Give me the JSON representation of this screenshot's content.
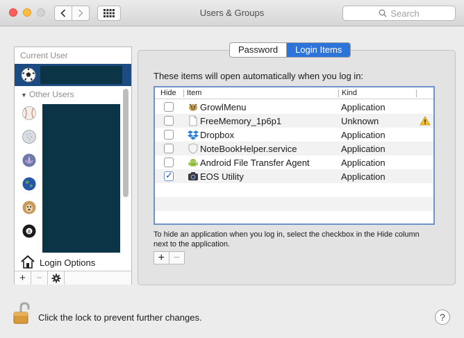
{
  "window": {
    "title": "Users & Groups",
    "search_placeholder": "Search"
  },
  "sidebar": {
    "current_user_label": "Current User",
    "other_users_label": "Other Users",
    "login_options_label": "Login Options",
    "footer": {
      "add": "+",
      "remove": "−"
    }
  },
  "tabs": [
    {
      "label": "Password",
      "active": false
    },
    {
      "label": "Login Items",
      "active": true
    }
  ],
  "login_items": {
    "intro": "These items will open automatically when you log in:",
    "columns": {
      "hide": "Hide",
      "item": "Item",
      "kind": "Kind"
    },
    "rows": [
      {
        "name": "GrowlMenu",
        "kind": "Application",
        "hidden": false,
        "icon": "growl-icon",
        "warning": false
      },
      {
        "name": "FreeMemory_1p6p1",
        "kind": "Unknown",
        "hidden": false,
        "icon": "document-icon",
        "warning": true
      },
      {
        "name": "Dropbox",
        "kind": "Application",
        "hidden": false,
        "icon": "dropbox-icon",
        "warning": false
      },
      {
        "name": "NoteBookHelper.service",
        "kind": "Application",
        "hidden": false,
        "icon": "shield-icon",
        "warning": false
      },
      {
        "name": "Android File Transfer Agent",
        "kind": "Application",
        "hidden": false,
        "icon": "android-icon",
        "warning": false
      },
      {
        "name": "EOS Utility",
        "kind": "Application",
        "hidden": true,
        "icon": "camera-icon",
        "warning": false
      }
    ],
    "hint": "To hide an application when you log in, select the checkbox in the Hide column next to the application.",
    "add": "+",
    "remove": "−"
  },
  "footer": {
    "lock_text": "Click the lock to prevent further changes.",
    "help": "?"
  },
  "colors": {
    "accent": "#2d74da",
    "selection": "#1b4b80",
    "redacted": "#0b3447"
  }
}
